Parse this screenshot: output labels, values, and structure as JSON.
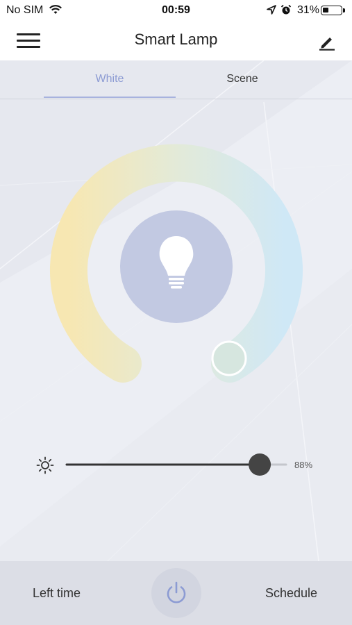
{
  "status_bar": {
    "carrier": "No SIM",
    "time": "00:59",
    "battery": "31%"
  },
  "nav": {
    "title": "Smart Lamp"
  },
  "tabs": [
    {
      "label": "White",
      "active": true
    },
    {
      "label": "Scene",
      "active": false
    }
  ],
  "brightness": {
    "value": 0.88,
    "label": "88%"
  },
  "bottom": {
    "left_time_label": "Left time",
    "schedule_label": "Schedule"
  },
  "colors": {
    "accent": "#8c9bd3",
    "bulb_circle": "#c2c9e2",
    "warm": "#f7e7b2",
    "cool": "#cfe8f6"
  },
  "icons": [
    "wifi-icon",
    "location-icon",
    "alarm-icon",
    "battery-icon",
    "menu-icon",
    "edit-icon",
    "bulb-icon",
    "brightness-icon",
    "power-icon"
  ]
}
